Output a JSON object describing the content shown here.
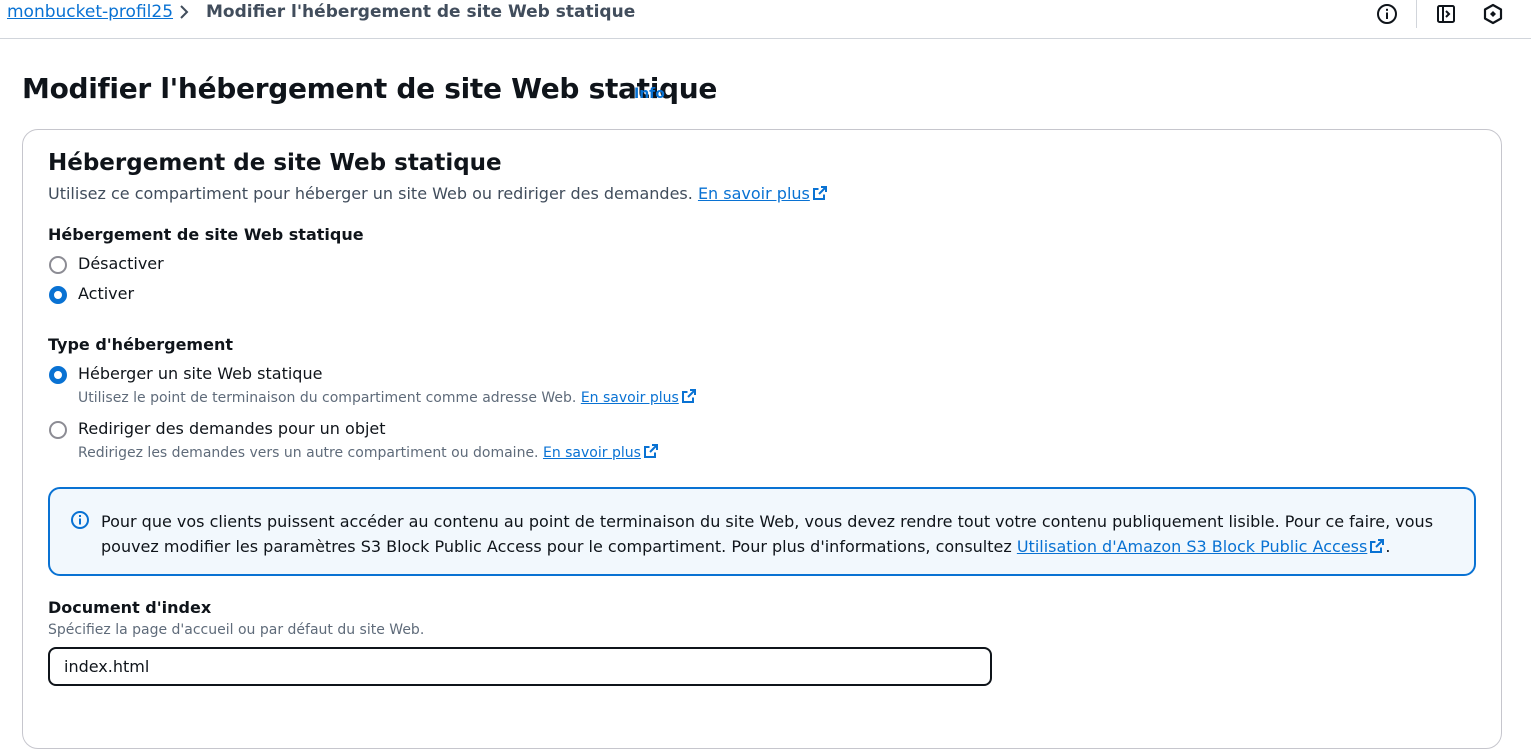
{
  "breadcrumb": {
    "parent": "monbucket-profil25",
    "current": "Modifier l'hébergement de site Web statique"
  },
  "top_icons": [
    "info-circle-icon",
    "panel-icon",
    "settings-hex-icon"
  ],
  "page": {
    "title": "Modifier l'hébergement de site Web statique",
    "info_link": "Info"
  },
  "section": {
    "title": "Hébergement de site Web statique",
    "description": "Utilisez ce compartiment pour héberger un site Web ou rediriger des demandes.",
    "learn_more": "En savoir plus"
  },
  "hosting": {
    "label": "Hébergement de site Web statique",
    "options": [
      {
        "label": "Désactiver",
        "checked": false
      },
      {
        "label": "Activer",
        "checked": true
      }
    ]
  },
  "hosting_type": {
    "label": "Type d'hébergement",
    "options": [
      {
        "label": "Héberger un site Web statique",
        "description": "Utilisez le point de terminaison du compartiment comme adresse Web.",
        "link": "En savoir plus",
        "checked": true
      },
      {
        "label": "Rediriger des demandes pour un objet",
        "description": "Redirigez les demandes vers un autre compartiment ou domaine.",
        "link": "En savoir plus",
        "checked": false
      }
    ]
  },
  "alert": {
    "text": "Pour que vos clients puissent accéder au contenu au point de terminaison du site Web, vous devez rendre tout votre contenu publiquement lisible. Pour ce faire, vous pouvez modifier les paramètres S3 Block Public Access pour le compartiment. Pour plus d'informations, consultez",
    "link": "Utilisation d'Amazon S3 Block Public Access",
    "suffix": "."
  },
  "index_document": {
    "label": "Document d'index",
    "description": "Spécifiez la page d'accueil ou par défaut du site Web.",
    "value": "index.html"
  },
  "colors": {
    "link": "#0972d3",
    "alert_bg": "#f2f8fd",
    "text": "#0f141a"
  }
}
